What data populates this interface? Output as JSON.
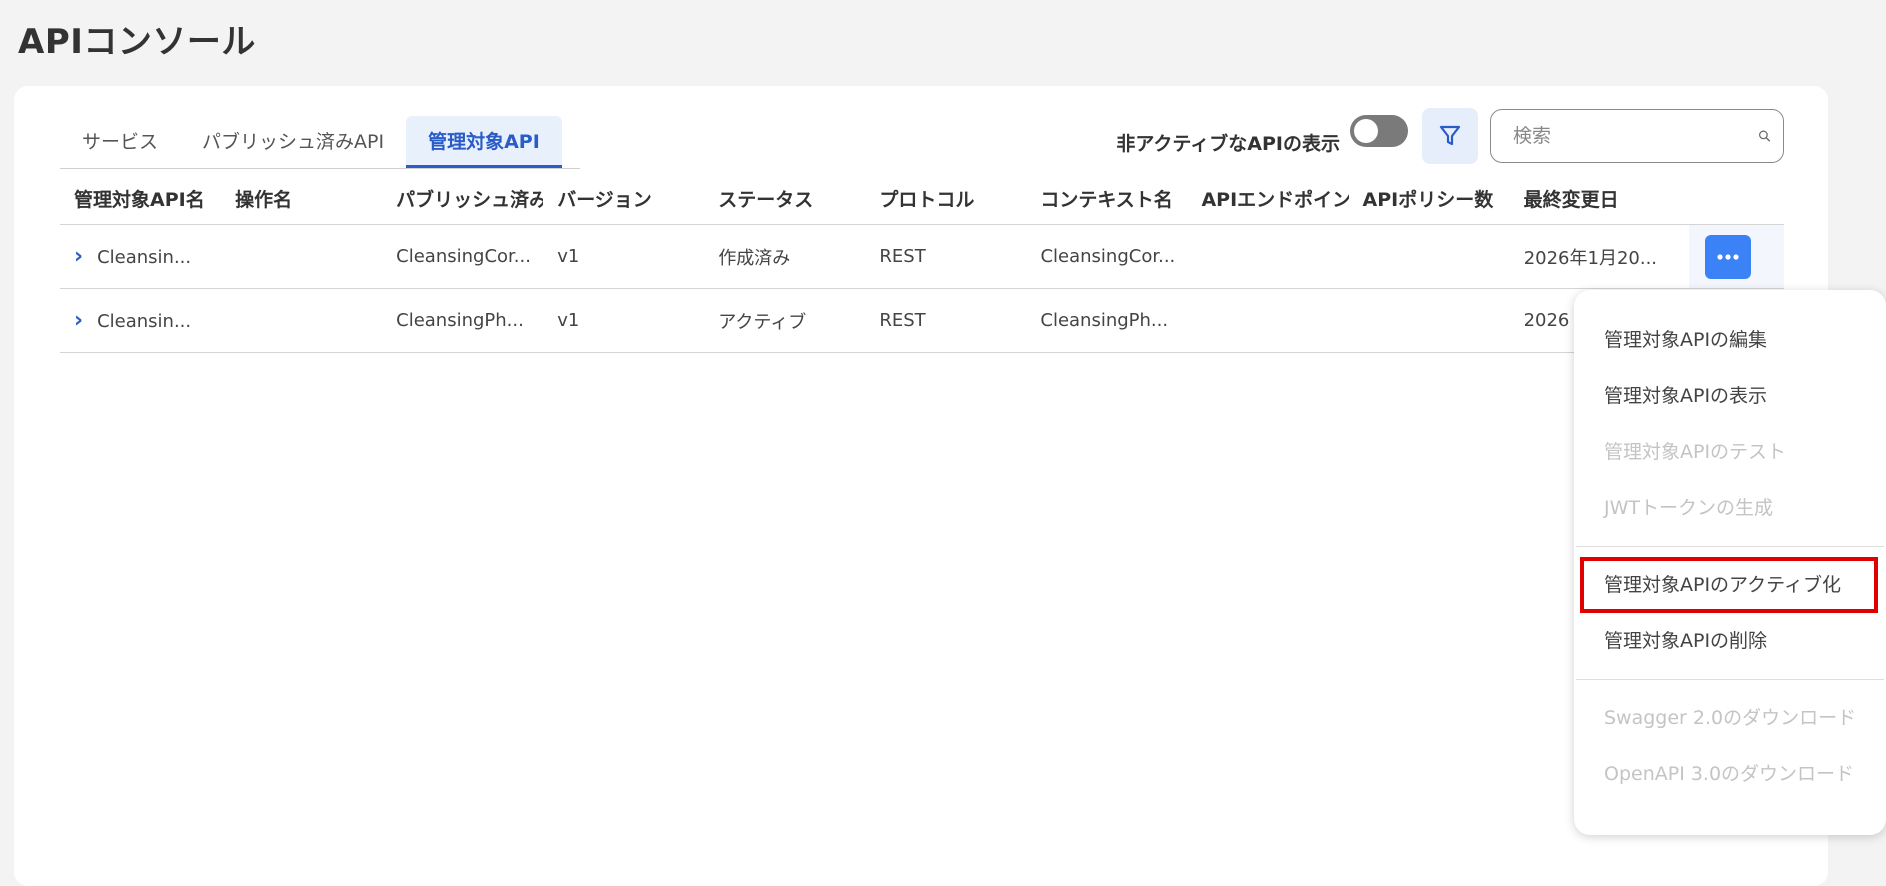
{
  "page": {
    "title": "APIコンソール"
  },
  "tabs": [
    {
      "label": "サービス",
      "active": false
    },
    {
      "label": "パブリッシュ済みAPI",
      "active": false
    },
    {
      "label": "管理対象API",
      "active": true
    }
  ],
  "toolbar": {
    "toggle_label": "非アクティブなAPIの表示",
    "toggle_on": false,
    "search_placeholder": "検索"
  },
  "table": {
    "columns": [
      "管理対象API名",
      "操作名",
      "パブリッシュ済み",
      "バージョン",
      "ステータス",
      "プロトコル",
      "コンテキスト名",
      "APIエンドポイン",
      "APIポリシー数",
      "最終変更日"
    ],
    "rows": [
      {
        "name": "Cleansin...",
        "operation": "",
        "published": "CleansingCor...",
        "version": "v1",
        "status": "作成済み",
        "protocol": "REST",
        "context": "CleansingCor...",
        "endpoint": "",
        "policies": "",
        "modified": "2026年1月20..."
      },
      {
        "name": "Cleansin...",
        "operation": "",
        "published": "CleansingPh...",
        "version": "v1",
        "status": "アクティブ",
        "protocol": "REST",
        "context": "CleansingPh...",
        "endpoint": "",
        "policies": "",
        "modified": "2026"
      }
    ]
  },
  "menu": {
    "items": [
      {
        "label": "管理対象APIの編集",
        "disabled": false
      },
      {
        "label": "管理対象APIの表示",
        "disabled": false
      },
      {
        "label": "管理対象APIのテスト",
        "disabled": true
      },
      {
        "label": "JWTトークンの生成",
        "disabled": true
      },
      {
        "label": "管理対象APIのアクティブ化",
        "disabled": false,
        "highlighted": true
      },
      {
        "label": "管理対象APIの削除",
        "disabled": false
      },
      {
        "label": "Swagger 2.0のダウンロード",
        "disabled": true
      },
      {
        "label": "OpenAPI 3.0のダウンロード",
        "disabled": true
      }
    ]
  },
  "colors": {
    "accent": "#2a5cc7",
    "button_blue": "#3b82f6",
    "highlight_red": "#e00000"
  },
  "icons": {
    "filter": "filter-icon",
    "search": "search-icon",
    "expand": "chevron-right-icon",
    "more": "more-horizontal-icon"
  }
}
